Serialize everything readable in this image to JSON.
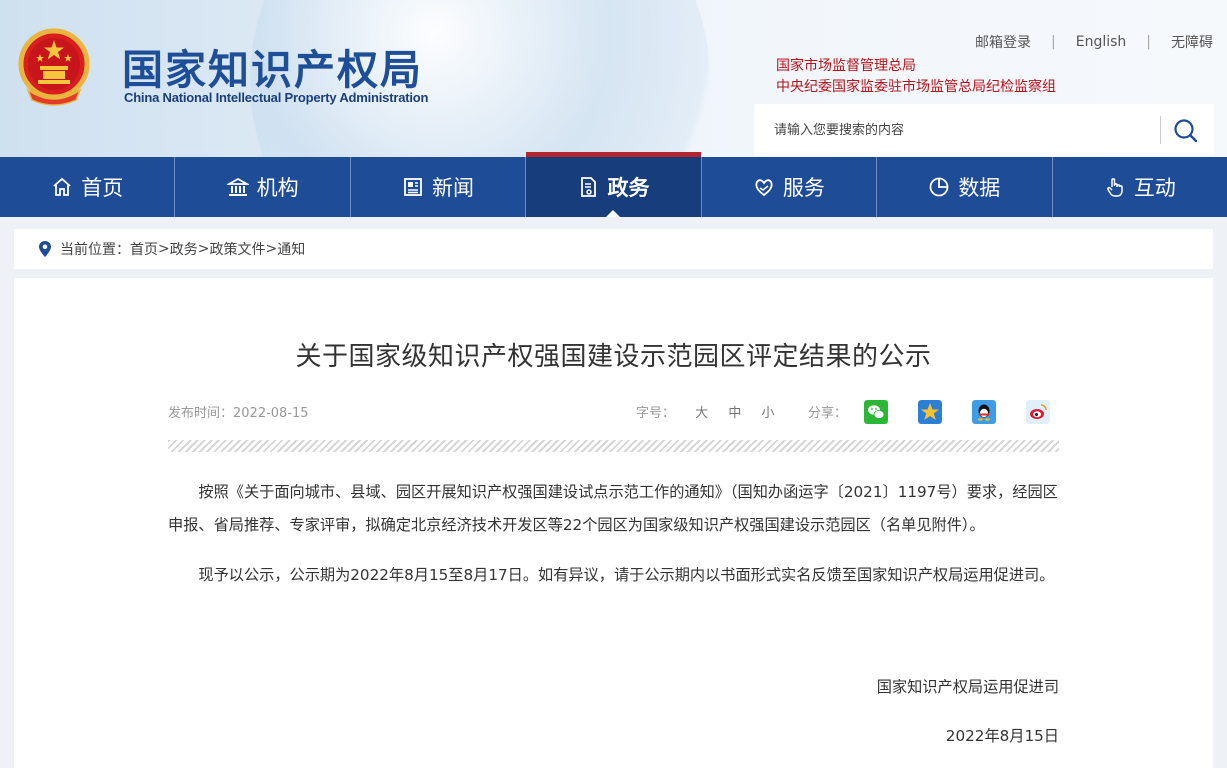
{
  "header": {
    "title": "国家知识产权局",
    "subtitle": "China National Intellectual Property Administration",
    "top_links": [
      "邮箱登录",
      "English",
      "无障碍"
    ],
    "org_links": [
      "国家市场监督管理总局",
      "中央纪委国家监委驻市场监管总局纪检监察组"
    ],
    "search_placeholder": "请输入您要搜索的内容"
  },
  "nav": {
    "items": [
      {
        "label": "首页",
        "icon": "home-icon"
      },
      {
        "label": "机构",
        "icon": "institution-icon"
      },
      {
        "label": "新闻",
        "icon": "newspaper-icon"
      },
      {
        "label": "政务",
        "icon": "document-icon",
        "active": true
      },
      {
        "label": "服务",
        "icon": "heart-hand-icon"
      },
      {
        "label": "数据",
        "icon": "pie-chart-icon"
      },
      {
        "label": "互动",
        "icon": "hand-pointer-icon"
      }
    ],
    "active_index": 3
  },
  "breadcrumb": {
    "prefix": "当前位置：",
    "items": [
      "首页",
      "政务",
      "政策文件",
      "通知"
    ],
    "separator": ">"
  },
  "article": {
    "title": "关于国家级知识产权强国建设示范园区评定结果的公示",
    "publish_label": "发布时间：",
    "publish_date": "2022-08-15",
    "fontsize_label": "字号：",
    "fontsize_options": [
      "大",
      "中",
      "小"
    ],
    "share_label": "分享：",
    "share_icons": [
      "wechat-icon",
      "qzone-icon",
      "qq-icon",
      "weibo-icon"
    ],
    "paragraphs": [
      "按照《关于面向城市、县域、园区开展知识产权强国建设试点示范工作的通知》（国知办函运字〔2021〕1197号）要求，经园区申报、省局推荐、专家评审，拟确定北京经济技术开发区等22个园区为国家级知识产权强国建设示范园区（名单见附件）。",
      "现予以公示，公示期为2022年8月15至8月17日。如有异议，请于公示期内以书面形式实名反馈至国家知识产权局运用促进司。"
    ],
    "signature": "国家知识产权局运用促进司",
    "sign_date": "2022年8月15日"
  },
  "colors": {
    "brand_blue": "#1f4c96",
    "nav_active": "#173d7c",
    "accent_red": "#b2262f",
    "org_link_red": "#b4131b"
  }
}
